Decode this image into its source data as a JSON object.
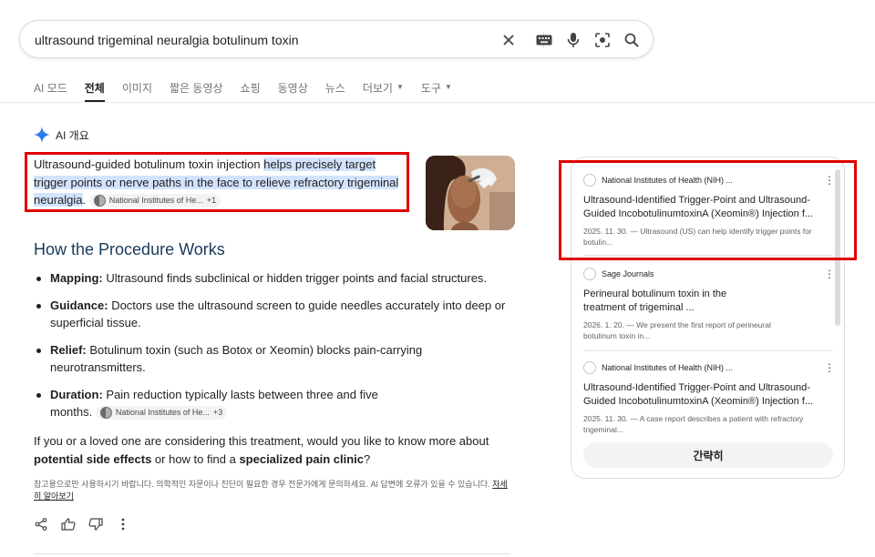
{
  "search": {
    "query": "ultrasound trigeminal neuralgia botulinum toxin",
    "icons": [
      "close-icon",
      "keyboard-icon",
      "mic-icon",
      "camera-search-icon",
      "search-icon"
    ]
  },
  "tabs": [
    {
      "label": "AI 모드"
    },
    {
      "label": "전체",
      "active": true
    },
    {
      "label": "이미지"
    },
    {
      "label": "짧은 동영상"
    },
    {
      "label": "쇼핑"
    },
    {
      "label": "동영상"
    },
    {
      "label": "뉴스"
    },
    {
      "label": "더보기",
      "dropdown": true
    },
    {
      "label": "도구",
      "dropdown": true
    }
  ],
  "ai_overview": {
    "label": "AI 개요",
    "intro_plain": "Ultrasound-guided botulinum toxin injection ",
    "intro_highlight": "helps precisely target trigger points or nerve paths in the face to relieve refractory trigeminal neuralgia",
    "intro_end": ".",
    "intro_chip": "National Institutes of He...",
    "intro_chip_count": "+1",
    "section_title": "How the Procedure Works",
    "bullets": [
      {
        "term": "Mapping:",
        "text": " Ultrasound finds subclinical or hidden trigger points and facial structures."
      },
      {
        "term": "Guidance:",
        "text": " Doctors use the ultrasound screen to guide needles accurately into deep or superficial tissue."
      },
      {
        "term": "Relief:",
        "text": " Botulinum toxin (such as Botox or Xeomin) blocks pain-carrying neurotransmitters."
      },
      {
        "term": "Duration:",
        "text": " Pain reduction typically lasts between three and five months."
      }
    ],
    "bullet_chip": "National Institutes of He...",
    "bullet_chip_count": "+3",
    "followup_1": "If you or a loved one are considering this treatment, would you like to know more about ",
    "followup_b1": "potential side effects",
    "followup_2": " or how to find a ",
    "followup_b2": "specialized pain clinic",
    "followup_3": "?",
    "disclaimer": "참고용으로만 사용하시기 바랍니다. 의학적인 자문이나 진단이 필요한 경우 전문가에게 문의하세요. AI 답변에 오류가 있을 수 있습니다. ",
    "learn_more": "자세히 알아보기"
  },
  "sources": [
    {
      "site": "National Institutes of Health (NIH) ...",
      "title": "Ultrasound-Identified Trigger-Point and Ultrasound-Guided IncobotulinumtoxinA (Xeomin®) Injection f...",
      "snippet": "2025. 11. 30. — Ultrasound (US) can help identify trigger points for botulin..."
    },
    {
      "site": "Sage Journals",
      "title": "Perineural botulinum toxin in the treatment of trigeminal ...",
      "snippet": "2026. 1. 20. — We present the first report of perineural botulinum toxin in..."
    },
    {
      "site": "National Institutes of Health (NIH) ...",
      "title": "Ultrasound-Identified Trigger-Point and Ultrasound-Guided IncobotulinumtoxinA (Xeomin®) Injection f...",
      "snippet": "2025. 11. 30. — A case report describes a patient with refractory trigeminal..."
    }
  ],
  "sources_button": "간략히",
  "colors": {
    "highlight": "#d3e3fd",
    "annotation_red": "#e00000",
    "heading": "#1a3a5c"
  }
}
